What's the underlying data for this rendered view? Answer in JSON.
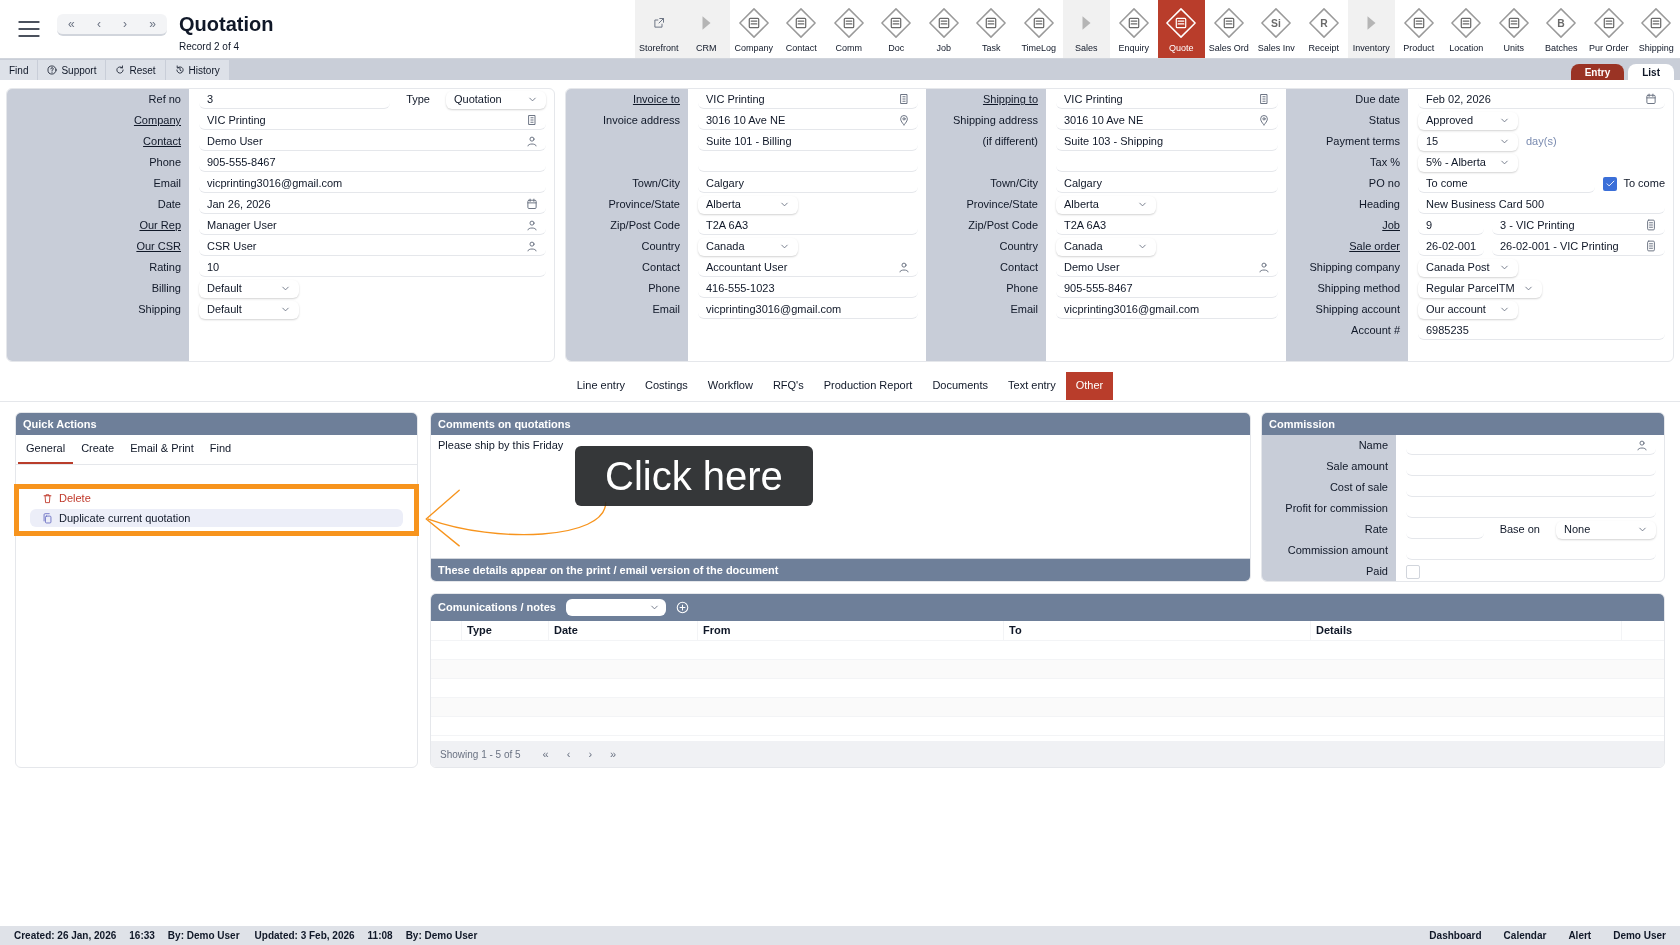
{
  "header": {
    "nav_buttons": [
      "«",
      "‹",
      "›",
      "»"
    ],
    "title": "Quotation",
    "subtitle": "Record 2 of 4"
  },
  "modules": [
    {
      "label": "Storefront",
      "kind": "link",
      "selected": false
    },
    {
      "label": "CRM",
      "kind": "group",
      "selected": false
    },
    {
      "label": "Company",
      "kind": "module",
      "selected": false
    },
    {
      "label": "Contact",
      "kind": "module",
      "selected": false
    },
    {
      "label": "Comm",
      "kind": "module",
      "selected": false
    },
    {
      "label": "Doc",
      "kind": "module",
      "selected": false
    },
    {
      "label": "Job",
      "kind": "module",
      "selected": false
    },
    {
      "label": "Task",
      "kind": "module",
      "selected": false
    },
    {
      "label": "TimeLog",
      "kind": "module",
      "selected": false
    },
    {
      "label": "Sales",
      "kind": "group",
      "selected": false
    },
    {
      "label": "Enquiry",
      "kind": "module",
      "selected": false
    },
    {
      "label": "Quote",
      "kind": "module",
      "selected": true
    },
    {
      "label": "Sales Ord",
      "kind": "module",
      "selected": false
    },
    {
      "label": "Sales Inv",
      "kind": "module",
      "selected": false,
      "glyph": "Si"
    },
    {
      "label": "Receipt",
      "kind": "module",
      "selected": false,
      "glyph": "R"
    },
    {
      "label": "Inventory",
      "kind": "group",
      "selected": false
    },
    {
      "label": "Product",
      "kind": "module",
      "selected": false
    },
    {
      "label": "Location",
      "kind": "module",
      "selected": false
    },
    {
      "label": "Units",
      "kind": "module",
      "selected": false
    },
    {
      "label": "Batches",
      "kind": "module",
      "selected": false,
      "glyph": "B"
    },
    {
      "label": "Pur Order",
      "kind": "module",
      "selected": false
    },
    {
      "label": "Shipping",
      "kind": "module",
      "selected": false
    }
  ],
  "actions": [
    {
      "label": "Find"
    },
    {
      "label": "Support"
    },
    {
      "label": "Reset"
    },
    {
      "label": "History"
    }
  ],
  "view_tabs": [
    {
      "label": "Entry",
      "selected": true
    },
    {
      "label": "List",
      "selected": false
    }
  ],
  "form_cards": [
    {
      "sections": [
        {
          "rows": [
            {
              "label": "Ref no",
              "fields": [
                {
                  "kind": "input",
                  "value": "3"
                },
                {
                  "kind": "label",
                  "value": "Type"
                },
                {
                  "kind": "select",
                  "value": "Quotation"
                }
              ]
            },
            {
              "label": "Company",
              "link": true,
              "fields": [
                {
                  "kind": "company_lookup",
                  "value": "VIC Printing"
                }
              ]
            },
            {
              "label": "Contact",
              "link": true,
              "fields": [
                {
                  "kind": "person_lookup",
                  "value": "Demo User"
                }
              ]
            },
            {
              "label": "Phone",
              "fields": [
                {
                  "kind": "input",
                  "value": "905-555-8467"
                }
              ]
            },
            {
              "label": "Email",
              "fields": [
                {
                  "kind": "input",
                  "value": "vicprinting3016@gmail.com"
                }
              ]
            },
            {
              "label": "Date",
              "fields": [
                {
                  "kind": "date",
                  "value": "Jan 26, 2026"
                }
              ]
            },
            {
              "label": "Our Rep",
              "link": true,
              "fields": [
                {
                  "kind": "person_lookup",
                  "value": "Manager User"
                }
              ]
            },
            {
              "label": "Our CSR",
              "link": true,
              "fields": [
                {
                  "kind": "person_lookup",
                  "value": "CSR User"
                }
              ]
            },
            {
              "label": "Rating",
              "fields": [
                {
                  "kind": "input",
                  "value": "10"
                }
              ]
            },
            {
              "label": "Billing",
              "fields": [
                {
                  "kind": "select",
                  "value": "Default"
                }
              ]
            },
            {
              "label": "Shipping",
              "fields": [
                {
                  "kind": "select",
                  "value": "Default"
                }
              ]
            }
          ]
        }
      ]
    },
    {
      "sections": [
        {
          "rows": [
            {
              "label": "Invoice to",
              "link": true,
              "fields": [
                {
                  "kind": "company_lookup",
                  "value": "VIC Printing"
                }
              ]
            },
            {
              "label": "Invoice address",
              "fields": [
                {
                  "kind": "address",
                  "value": "3016 10 Ave NE"
                }
              ]
            },
            {
              "fields": [
                {
                  "kind": "input",
                  "value": "Suite 101 - Billing"
                }
              ]
            },
            {
              "fields": [
                {
                  "kind": "input"
                }
              ]
            },
            {
              "label": "Town/City",
              "fields": [
                {
                  "kind": "input",
                  "value": "Calgary"
                }
              ]
            },
            {
              "label": "Province/State",
              "fields": [
                {
                  "kind": "select",
                  "value": "Alberta"
                }
              ]
            },
            {
              "label": "Zip/Post Code",
              "fields": [
                {
                  "kind": "input",
                  "value": "T2A 6A3"
                }
              ]
            },
            {
              "label": "Country",
              "fields": [
                {
                  "kind": "select",
                  "value": "Canada"
                }
              ]
            },
            {
              "label": "Contact",
              "fields": [
                {
                  "kind": "person_lookup",
                  "value": "Accountant User"
                }
              ]
            },
            {
              "label": "Phone",
              "fields": [
                {
                  "kind": "input",
                  "value": "416-555-1023"
                }
              ]
            },
            {
              "label": "Email",
              "fields": [
                {
                  "kind": "input",
                  "value": "vicprinting3016@gmail.com"
                }
              ]
            }
          ]
        },
        {
          "rows": [
            {
              "label": "Shipping to",
              "link": true,
              "fields": [
                {
                  "kind": "company_lookup",
                  "value": "VIC Printing"
                }
              ]
            },
            {
              "label": "Shipping address",
              "fields": [
                {
                  "kind": "address",
                  "value": "3016 10 Ave NE"
                }
              ]
            },
            {
              "label": "(if different)",
              "fields": [
                {
                  "kind": "input",
                  "value": "Suite 103 - Shipping"
                }
              ]
            },
            {
              "fields": [
                {
                  "kind": "input"
                }
              ]
            },
            {
              "label": "Town/City",
              "fields": [
                {
                  "kind": "input",
                  "value": "Calgary"
                }
              ]
            },
            {
              "label": "Province/State",
              "fields": [
                {
                  "kind": "select",
                  "value": "Alberta"
                }
              ]
            },
            {
              "label": "Zip/Post Code",
              "fields": [
                {
                  "kind": "input",
                  "value": "T2A 6A3"
                }
              ]
            },
            {
              "label": "Country",
              "fields": [
                {
                  "kind": "select",
                  "value": "Canada"
                }
              ]
            },
            {
              "label": "Contact",
              "fields": [
                {
                  "kind": "person_lookup",
                  "value": "Demo User"
                }
              ]
            },
            {
              "label": "Phone",
              "fields": [
                {
                  "kind": "input",
                  "value": "905-555-8467"
                }
              ]
            },
            {
              "label": "Email",
              "fields": [
                {
                  "kind": "input",
                  "value": "vicprinting3016@gmail.com"
                }
              ]
            }
          ]
        },
        {
          "rows": [
            {
              "label": "Due date",
              "fields": [
                {
                  "kind": "date",
                  "value": "Feb 02, 2026"
                }
              ]
            },
            {
              "label": "Status",
              "fields": [
                {
                  "kind": "select",
                  "value": "Approved"
                }
              ]
            },
            {
              "label": "Payment terms",
              "fields": [
                {
                  "kind": "select",
                  "value": "15"
                },
                {
                  "kind": "note",
                  "value": "day(s)"
                }
              ]
            },
            {
              "label": "Tax %",
              "fields": [
                {
                  "kind": "select",
                  "value": "5% - Alberta"
                }
              ]
            },
            {
              "label": "PO no",
              "fields": [
                {
                  "kind": "input",
                  "value": "To come"
                },
                {
                  "kind": "checkbox",
                  "checked": true,
                  "label": "To come"
                }
              ]
            },
            {
              "label": "Heading",
              "fields": [
                {
                  "kind": "input",
                  "value": "New Business Card 500"
                }
              ]
            },
            {
              "label": "Job",
              "link": true,
              "fields": [
                {
                  "kind": "input",
                  "value": "9"
                },
                {
                  "kind": "document_lookup",
                  "value": "3 - VIC Printing"
                }
              ]
            },
            {
              "label": "Sale order",
              "link": true,
              "fields": [
                {
                  "kind": "input",
                  "value": "26-02-001"
                },
                {
                  "kind": "document_lookup",
                  "value": "26-02-001 - VIC Printing"
                }
              ]
            },
            {
              "label": "Shipping company",
              "fields": [
                {
                  "kind": "select",
                  "value": "Canada Post"
                }
              ]
            },
            {
              "label": "Shipping method",
              "fields": [
                {
                  "kind": "select",
                  "value": "Regular ParcelTM"
                }
              ]
            },
            {
              "label": "Shipping account",
              "fields": [
                {
                  "kind": "select",
                  "value": "Our account"
                }
              ]
            },
            {
              "label": "Account #",
              "fields": [
                {
                  "kind": "input",
                  "value": "6985235"
                }
              ]
            }
          ]
        }
      ]
    }
  ],
  "record_tabs": [
    {
      "label": "Line entry",
      "selected": false
    },
    {
      "label": "Costings",
      "selected": false
    },
    {
      "label": "Workflow",
      "selected": false
    },
    {
      "label": "RFQ's",
      "selected": false
    },
    {
      "label": "Production Report",
      "selected": false
    },
    {
      "label": "Documents",
      "selected": false
    },
    {
      "label": "Text entry",
      "selected": false
    },
    {
      "label": "Other",
      "selected": true
    }
  ],
  "quick_actions": {
    "title": "Quick Actions",
    "tabs": [
      {
        "label": "General",
        "selected": true
      },
      {
        "label": "Create",
        "selected": false
      },
      {
        "label": "Email & Print",
        "selected": false
      },
      {
        "label": "Find",
        "selected": false
      }
    ],
    "items": [
      {
        "label": "Delete",
        "kind": "danger",
        "selected": false
      },
      {
        "label": "Duplicate current quotation",
        "kind": "normal",
        "selected": true
      }
    ]
  },
  "comments": {
    "title": "Comments on quotations",
    "text": "Please ship by this Friday",
    "footer": "These details appear on the print / email version of the document"
  },
  "commission": {
    "title": "Commission",
    "rows": [
      {
        "label": "Name",
        "fields": [
          {
            "kind": "person_lookup"
          }
        ]
      },
      {
        "label": "Sale amount",
        "fields": [
          {
            "kind": "input"
          }
        ]
      },
      {
        "label": "Cost of sale",
        "fields": [
          {
            "kind": "input"
          }
        ]
      },
      {
        "label": "Profit for commission",
        "fields": [
          {
            "kind": "input"
          }
        ]
      },
      {
        "label": "Rate",
        "fields": [
          {
            "kind": "input"
          },
          {
            "kind": "label",
            "value": "Base on"
          },
          {
            "kind": "select",
            "value": "None"
          }
        ]
      },
      {
        "label": "Commission amount",
        "fields": [
          {
            "kind": "input"
          }
        ]
      },
      {
        "label": "Paid",
        "fields": [
          {
            "kind": "checkbox",
            "checked": false
          }
        ]
      }
    ]
  },
  "communications": {
    "title": "Comunications / notes",
    "columns": [
      "Type",
      "Date",
      "From",
      "To",
      "Details"
    ],
    "footer": "Showing 1 - 5 of 5",
    "pager": [
      "«",
      "‹",
      "›",
      "»"
    ]
  },
  "annotation": {
    "callout": "Click here"
  },
  "status_bar": {
    "left": [
      "Created: 26 Jan, 2026",
      "16:33",
      "By: Demo User",
      "Updated: 3 Feb, 2026",
      "11:08",
      "By: Demo User"
    ],
    "right": [
      "Dashboard",
      "Calendar",
      "Alert",
      "Demo User"
    ]
  }
}
